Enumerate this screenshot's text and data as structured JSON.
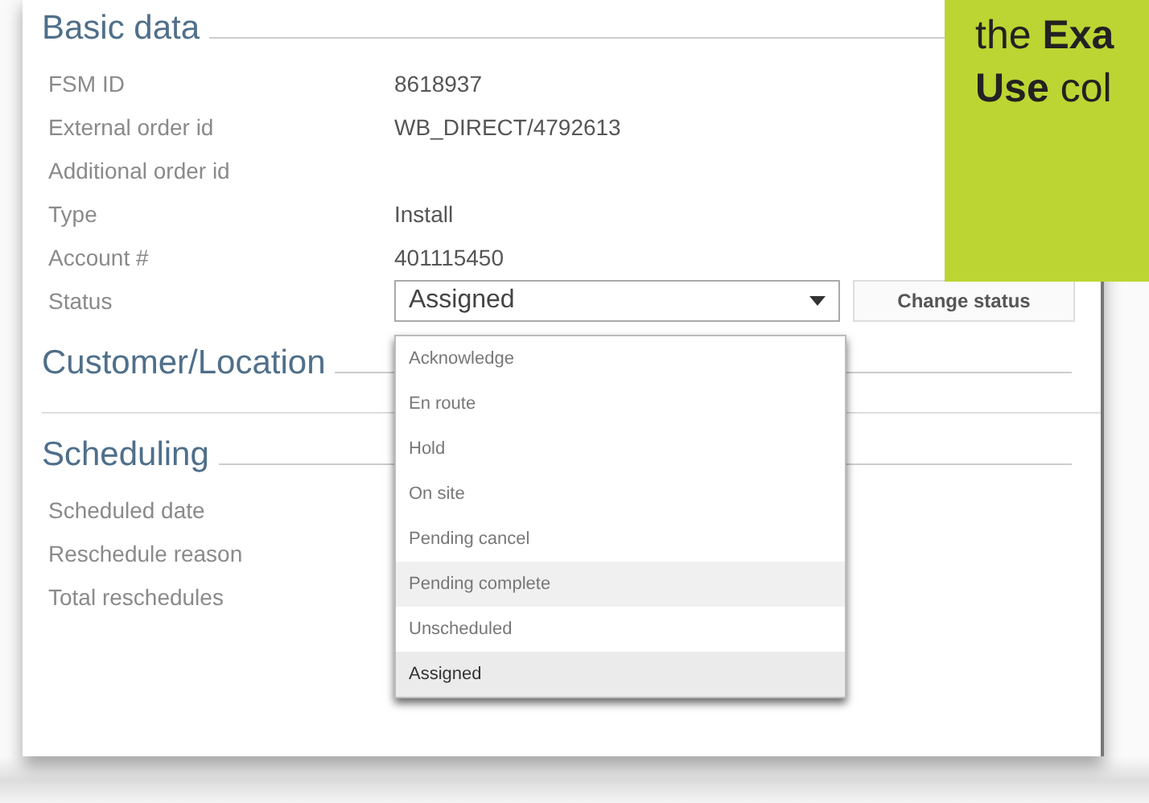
{
  "sections": [
    {
      "title": "Basic data",
      "fields": [
        {
          "label": "FSM ID",
          "value": "8618937",
          "kind": "text"
        },
        {
          "label": "External order id",
          "value": "WB_DIRECT/4792613",
          "kind": "text"
        },
        {
          "label": "Additional order id",
          "kind": "text"
        },
        {
          "label": "Type",
          "value": "Install",
          "kind": "text"
        },
        {
          "label": "Account #",
          "value": "401115450",
          "kind": "text"
        },
        {
          "label": "Status",
          "value": "Assigned",
          "kind": "select",
          "button": "Change status",
          "expanded": true,
          "options": [
            {
              "label": "Acknowledge",
              "selected": false,
              "highlighted": false
            },
            {
              "label": "En route",
              "selected": false,
              "highlighted": false
            },
            {
              "label": "Hold",
              "selected": false,
              "highlighted": false
            },
            {
              "label": "On site",
              "selected": false,
              "highlighted": false
            },
            {
              "label": "Pending cancel",
              "selected": false,
              "highlighted": false
            },
            {
              "label": "Pending complete",
              "selected": false,
              "highlighted": true
            },
            {
              "label": "Unscheduled",
              "selected": false,
              "highlighted": false
            },
            {
              "label": "Assigned",
              "selected": true,
              "highlighted": false
            }
          ]
        }
      ]
    },
    {
      "title": "Customer/Location"
    },
    {
      "title": "Scheduling",
      "fields": [
        {
          "label": "Scheduled date",
          "kind": "text"
        },
        {
          "label": "Reschedule reason",
          "kind": "text"
        },
        {
          "label": "Total reschedules",
          "kind": "text"
        }
      ]
    }
  ],
  "callout": {
    "lines": [
      "the **Exa**",
      "**Use** col"
    ]
  }
}
